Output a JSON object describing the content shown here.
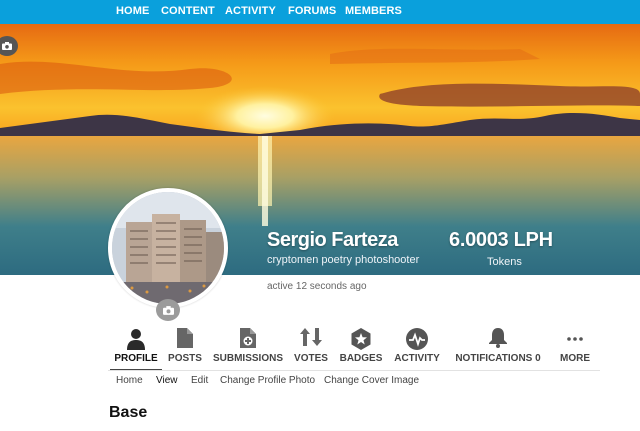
{
  "nav": {
    "items": [
      {
        "label": "HOME"
      },
      {
        "label": "CONTENT"
      },
      {
        "label": "ACTIVITY"
      },
      {
        "label": "FORUMS"
      },
      {
        "label": "MEMBERS"
      }
    ]
  },
  "profile": {
    "name": "Sergio Farteza",
    "tagline": "cryptomen poetry photoshooter",
    "balance": "6.0003 LPH",
    "balance_label": "Tokens",
    "active": "active 12 seconds ago"
  },
  "tabs": [
    {
      "label": "PROFILE",
      "icon": "person-icon"
    },
    {
      "label": "POSTS",
      "icon": "document-icon"
    },
    {
      "label": "SUBMISSIONS",
      "icon": "document-add-icon"
    },
    {
      "label": "VOTES",
      "icon": "up-down-arrows-icon"
    },
    {
      "label": "BADGES",
      "icon": "star-badge-icon"
    },
    {
      "label": "ACTIVITY",
      "icon": "pulse-icon"
    },
    {
      "label": "NOTIFICATIONS 0",
      "icon": "bell-icon"
    },
    {
      "label": "MORE",
      "icon": "more-dots-icon"
    }
  ],
  "subnav": [
    {
      "label": "Home"
    },
    {
      "label": "View"
    },
    {
      "label": "Edit"
    },
    {
      "label": "Change Profile Photo"
    },
    {
      "label": "Change Cover Image"
    }
  ],
  "section": {
    "title": "Base"
  },
  "colors": {
    "nav_bg": "#0aa0dc",
    "tab_active": "#111111"
  }
}
